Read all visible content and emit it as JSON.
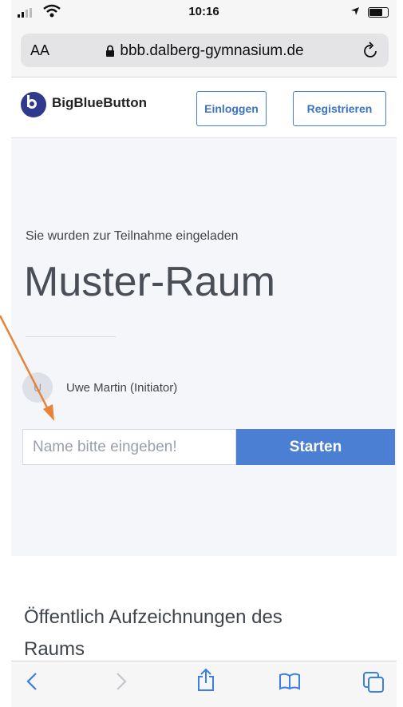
{
  "status_bar": {
    "time": "10:16"
  },
  "browser": {
    "text_size_label": "AA",
    "domain": "bbb.dalberg-gymnasium.de"
  },
  "header": {
    "brand": "BigBlueButton",
    "login_label": "Einloggen",
    "register_label": "Registrieren"
  },
  "main": {
    "invited_text": "Sie wurden zur Teilnahme eingeladen",
    "room_name": "Muster-Raum",
    "owner_initial": "U",
    "owner_name": "Uwe Martin (Initiator)",
    "name_placeholder": "Name bitte eingeben!",
    "start_label": "Starten"
  },
  "recordings": {
    "title": "Öffentlich Aufzeichnungen des Raums"
  },
  "colors": {
    "accent": "#4a7fd4",
    "brand": "#2f3a8c",
    "annotation_arrow": "#e8833a"
  },
  "toolbar": {
    "icons": [
      "back-icon",
      "forward-icon",
      "share-icon",
      "bookmarks-icon",
      "tabs-icon"
    ]
  }
}
